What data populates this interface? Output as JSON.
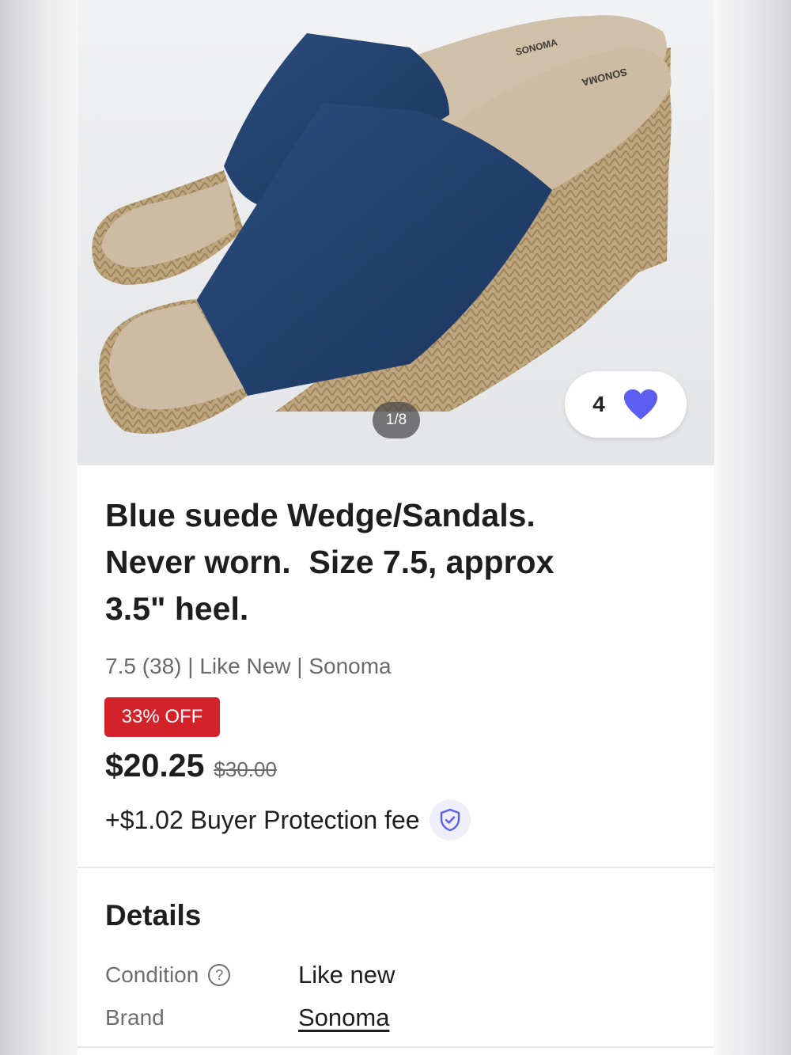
{
  "listing": {
    "image_counter": "1/8",
    "like_count": "4",
    "brand_imprint": "SONOMA",
    "title": "Blue suede Wedge/Sandals.\nNever worn.  Size 7.5, approx\n3.5\" heel.",
    "meta": "7.5 (38) | Like New | Sonoma",
    "discount_badge": "33% OFF",
    "price": "$20.25",
    "original_price": "$30.00",
    "buyer_protection_fee": "+$1.02 Buyer Protection fee"
  },
  "details": {
    "heading": "Details",
    "rows": [
      {
        "label": "Condition",
        "value": "Like new"
      },
      {
        "label": "Brand",
        "value": "Sonoma"
      }
    ]
  },
  "colors": {
    "heart": "#5b5ef0",
    "discount_bg": "#d3222a",
    "shoe_suede": "#213f6b",
    "insole": "#cdbba4",
    "jute": "#b39a73"
  },
  "icons": {
    "like": "heart-icon",
    "protection": "shield-check-icon",
    "condition_help": "question-circle-icon"
  }
}
